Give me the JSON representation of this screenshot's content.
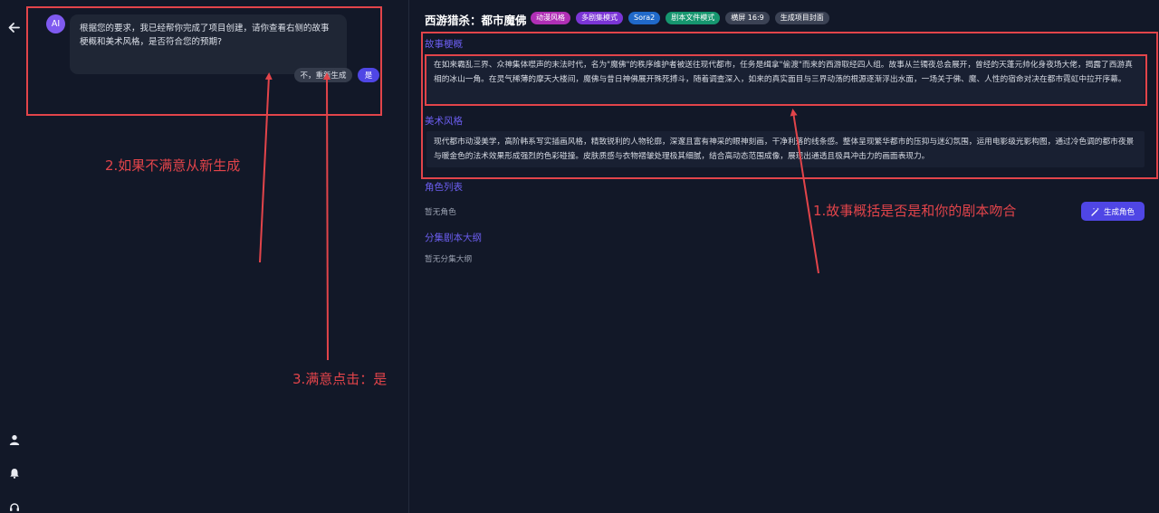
{
  "chat": {
    "avatar_label": "AI",
    "message": "根据您的要求，我已经帮你完成了项目创建，请你查看右侧的故事梗概和美术风格，是否符合您的预期?",
    "regenerate_label": "不，重新生成",
    "confirm_label": "是"
  },
  "project": {
    "title": "西游猎杀：都市魔佛",
    "tags": [
      {
        "label": "动漫风格",
        "color": "#b02fb5"
      },
      {
        "label": "多剧集模式",
        "color": "#7b35d6"
      },
      {
        "label": "Sora2",
        "color": "#2069c9"
      },
      {
        "label": "剧本文件模式",
        "color": "#16966f"
      },
      {
        "label": "横屏 16:9",
        "color": "#3b4254"
      },
      {
        "label": "生成项目封面",
        "color": "#3b4254"
      }
    ]
  },
  "sections": {
    "story_heading": "故事梗概",
    "story_text": "在如来霸乱三界、众神集体噤声的末法时代，名为\"魔佛\"的秩序维护者被送往现代都市，任务是缉拿\"偷渡\"而来的西游取经四人组。故事从兰镯夜总会展开，曾经的天蓬元帅化身夜场大佬，揭露了西游真相的冰山一角。在灵气稀薄的摩天大楼间，魔佛与昔日神佛展开殊死搏斗，随着调查深入，如来的真实面目与三界动荡的根源逐渐浮出水面，一场关于佛、魔、人性的宿命对决在都市霓虹中拉开序幕。",
    "art_heading": "美术风格",
    "art_text": "现代都市动漫美学，高阶韩系写实插画风格，精致锐利的人物轮廓，深邃且富有神采的眼神刻画，干净利落的线条感。整体呈现繁华都市的压抑与迷幻氛围，运用电影级光影构图，通过冷色调的都市夜景与暖金色的法术效果形成强烈的色彩碰撞。皮肤质感与衣物褶皱处理极其细腻，结合高动态范围成像，展现出通透且极具冲击力的画面表现力。",
    "characters_heading": "角色列表",
    "characters_empty": "暂无角色",
    "generate_characters_label": "生成角色",
    "outline_heading": "分集剧本大纲",
    "outline_empty": "暂无分集大纲"
  },
  "annotations": {
    "note1": "1.故事概括是否是和你的剧本吻合",
    "note2": "2.如果不满意从新生成",
    "note3": "3.满意点击：是",
    "color": "#e2444a"
  }
}
